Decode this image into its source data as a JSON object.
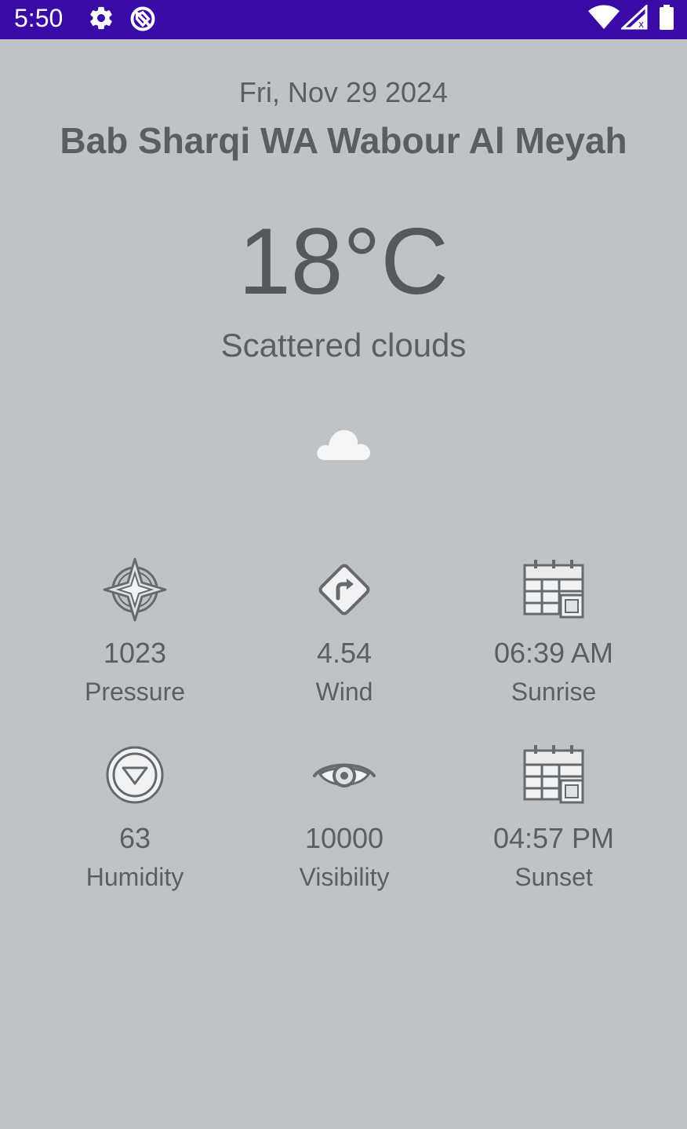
{
  "status_bar": {
    "time": "5:50",
    "icons": [
      "settings-gear-icon",
      "no-sim-circle-icon",
      "wifi-icon",
      "cell-signal-icon",
      "battery-icon"
    ],
    "background": "#3a0aa6"
  },
  "weather": {
    "date": "Fri, Nov 29 2024",
    "city": "Bab Sharqi WA Wabour Al Meyah",
    "temperature": "18°C",
    "condition": "Scattered clouds",
    "condition_icon": "cloud-icon"
  },
  "stats": [
    {
      "icon": "compass-icon",
      "value": "1023",
      "label": "Pressure"
    },
    {
      "icon": "wind-direction-icon",
      "value": "4.54",
      "label": "Wind"
    },
    {
      "icon": "calendar-icon",
      "value": "06:39 AM",
      "label": "Sunrise"
    },
    {
      "icon": "humidity-icon",
      "value": "63",
      "label": "Humidity"
    },
    {
      "icon": "eye-icon",
      "value": "10000",
      "label": "Visibility"
    },
    {
      "icon": "calendar-icon",
      "value": "04:57 PM",
      "label": "Sunset"
    }
  ],
  "colors": {
    "background": "#bec3c6",
    "text": "#5b5f63",
    "accent": "#3a0aa6"
  }
}
